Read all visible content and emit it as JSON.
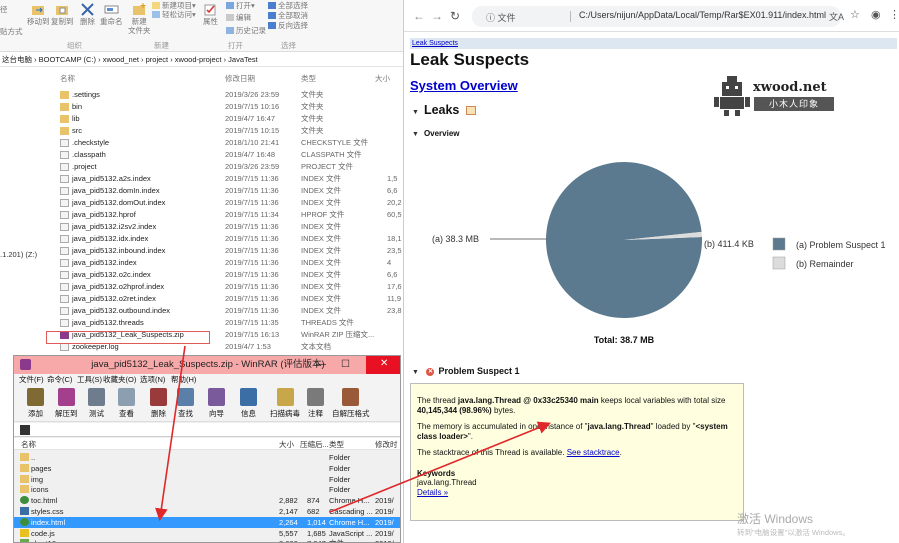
{
  "ribbon": {
    "partial_left": "径",
    "partial_left2": "贴方式",
    "move_to": "移动到",
    "copy_to": "复制到",
    "delete": "删除",
    "rename": "重命名",
    "new_folder_top": "新建",
    "new_folder_bottom": "文件夹",
    "new_item": "新建项目▾",
    "easy_access": "轻松访问▾",
    "properties": "属性",
    "open": "打开▾",
    "edit": "编辑",
    "history": "历史记录",
    "select_all": "全部选择",
    "select_none": "全部取消",
    "invert": "反向选择",
    "group_organize": "组织",
    "group_new": "新建",
    "group_open": "打开",
    "group_select": "选择"
  },
  "explorer": {
    "breadcrumb": "这台电脑 › BOOTCAMP (C:) › xwood_net › project › xwood-project › JavaTest",
    "columns": {
      "name": "名称",
      "date": "修改日期",
      "type": "类型",
      "size": "大小"
    },
    "leftnav_item": ".1.201) (Z:)",
    "files": [
      {
        "name": ".settings",
        "date": "2019/3/26 23:59",
        "type": "文件夹",
        "size": "",
        "icon": "folder-icon"
      },
      {
        "name": "bin",
        "date": "2019/7/15 10:16",
        "type": "文件夹",
        "size": "",
        "icon": "folder-icon"
      },
      {
        "name": "lib",
        "date": "2019/4/7 16:47",
        "type": "文件夹",
        "size": "",
        "icon": "folder-icon"
      },
      {
        "name": "src",
        "date": "2019/7/15 10:15",
        "type": "文件夹",
        "size": "",
        "icon": "folder-icon"
      },
      {
        "name": ".checkstyle",
        "date": "2018/1/10 21:41",
        "type": "CHECKSTYLE 文件",
        "size": "",
        "icon": "file-icon"
      },
      {
        "name": ".classpath",
        "date": "2019/4/7 16:48",
        "type": "CLASSPATH 文件",
        "size": "",
        "icon": "file-icon"
      },
      {
        "name": ".project",
        "date": "2019/3/26 23:59",
        "type": "PROJECT 文件",
        "size": "",
        "icon": "file-icon"
      },
      {
        "name": "java_pid5132.a2s.index",
        "date": "2019/7/15 11:36",
        "type": "INDEX 文件",
        "size": "1,5",
        "icon": "file-icon"
      },
      {
        "name": "java_pid5132.domIn.index",
        "date": "2019/7/15 11:36",
        "type": "INDEX 文件",
        "size": "6,6",
        "icon": "file-icon"
      },
      {
        "name": "java_pid5132.domOut.index",
        "date": "2019/7/15 11:36",
        "type": "INDEX 文件",
        "size": "20,2",
        "icon": "file-icon"
      },
      {
        "name": "java_pid5132.hprof",
        "date": "2019/7/15 11:34",
        "type": "HPROF 文件",
        "size": "60,5",
        "icon": "file-icon"
      },
      {
        "name": "java_pid5132.i2sv2.index",
        "date": "2019/7/15 11:36",
        "type": "INDEX 文件",
        "size": "",
        "icon": "file-icon"
      },
      {
        "name": "java_pid5132.idx.index",
        "date": "2019/7/15 11:36",
        "type": "INDEX 文件",
        "size": "18,1",
        "icon": "file-icon"
      },
      {
        "name": "java_pid5132.inbound.index",
        "date": "2019/7/15 11:36",
        "type": "INDEX 文件",
        "size": "23,5",
        "icon": "file-icon"
      },
      {
        "name": "java_pid5132.index",
        "date": "2019/7/15 11:36",
        "type": "INDEX 文件",
        "size": "4",
        "icon": "file-icon"
      },
      {
        "name": "java_pid5132.o2c.index",
        "date": "2019/7/15 11:36",
        "type": "INDEX 文件",
        "size": "6,6",
        "icon": "file-icon"
      },
      {
        "name": "java_pid5132.o2hprof.index",
        "date": "2019/7/15 11:36",
        "type": "INDEX 文件",
        "size": "17,6",
        "icon": "file-icon"
      },
      {
        "name": "java_pid5132.o2ret.index",
        "date": "2019/7/15 11:36",
        "type": "INDEX 文件",
        "size": "11,9",
        "icon": "file-icon"
      },
      {
        "name": "java_pid5132.outbound.index",
        "date": "2019/7/15 11:36",
        "type": "INDEX 文件",
        "size": "23,8",
        "icon": "file-icon"
      },
      {
        "name": "java_pid5132.threads",
        "date": "2019/7/15 11:35",
        "type": "THREADS 文件",
        "size": "",
        "icon": "file-icon"
      },
      {
        "name": "java_pid5132_Leak_Suspects.zip",
        "date": "2019/7/15 16:13",
        "type": "WinRAR ZIP 压缩文...",
        "size": "",
        "icon": "zip-icon"
      },
      {
        "name": "zookeeper.log",
        "date": "2019/4/7 1:53",
        "type": "文本文档",
        "size": "",
        "icon": "file-icon"
      }
    ]
  },
  "winrar": {
    "title": "java_pid5132_Leak_Suspects.zip - WinRAR (评估版本)",
    "menu": [
      "文件(F)",
      "命令(C)",
      "工具(S)",
      "收藏夹(O)",
      "选项(N)",
      "帮助(H)"
    ],
    "tools": [
      "添加",
      "解压到",
      "测试",
      "查看",
      "删除",
      "查找",
      "向导",
      "信息",
      "扫描病毒",
      "注释",
      "自解压格式"
    ],
    "tool_colors": [
      "#7f6a34",
      "#a33f8c",
      "#6e7c8d",
      "#8c9fb1",
      "#9a3a3a",
      "#5a7fa8",
      "#7a5a9a",
      "#3a6ea5",
      "#c8a64a",
      "#7a7a7a",
      "#9a5a3a"
    ],
    "columns": {
      "name": "名称",
      "size": "大小",
      "packed": "压缩后...",
      "type": "类型",
      "modified": "修改时"
    },
    "rows": [
      {
        "name": "..",
        "size": "",
        "packed": "",
        "type": "Folder",
        "modified": "",
        "icon": "folder-up-icon"
      },
      {
        "name": "pages",
        "size": "",
        "packed": "",
        "type": "Folder",
        "modified": "",
        "icon": "folder-icon"
      },
      {
        "name": "img",
        "size": "",
        "packed": "",
        "type": "Folder",
        "modified": "",
        "icon": "folder-icon"
      },
      {
        "name": "icons",
        "size": "",
        "packed": "",
        "type": "Folder",
        "modified": "",
        "icon": "folder-icon"
      },
      {
        "name": "toc.html",
        "size": "2,882",
        "packed": "874",
        "type": "Chrome H...",
        "modified": "2019/",
        "icon": "chrome-icon"
      },
      {
        "name": "styles.css",
        "size": "2,147",
        "packed": "682",
        "type": "Cascading ...",
        "modified": "2019/",
        "icon": "css-icon"
      },
      {
        "name": "index.html",
        "size": "2,264",
        "packed": "1,014",
        "type": "Chrome H...",
        "modified": "2019/",
        "icon": "chrome-icon"
      },
      {
        "name": "code.js",
        "size": "5,557",
        "packed": "1,685",
        "type": "JavaScript ...",
        "modified": "2019/",
        "icon": "js-icon"
      },
      {
        "name": "chart16.png",
        "size": "8,666",
        "packed": "7,847",
        "type": "文件 png",
        "modified": "2019/",
        "icon": "image-icon"
      }
    ],
    "selected_index": 6
  },
  "chrome": {
    "omnibox_info": "ⓘ 文件",
    "url": "C:/Users/nijun/AppData/Local/Temp/Rar$EX01.911/index.html",
    "breadcrumb_link": "Leak Suspects",
    "title": "Leak Suspects",
    "system_overview": "System Overview",
    "leaks_heading": "Leaks",
    "overview_heading": "Overview",
    "logo_text": "xwood.net",
    "logo_sub": "小木人印象",
    "problem_heading": "Problem Suspect 1",
    "problem_p1_a": "The thread ",
    "problem_p1_b": "java.lang.Thread @ 0x33c25340 main",
    "problem_p1_c": " keeps local variables with total size ",
    "problem_p1_d": "40,145,344 (98.96%)",
    "problem_p1_e": " bytes.",
    "problem_p2_a": "The memory is accumulated in one instance of \"",
    "problem_p2_b": "java.lang.Thread",
    "problem_p2_c": "\" loaded by \"",
    "problem_p2_d": "<system class loader>",
    "problem_p2_e": "\".",
    "problem_p3_a": "The stacktrace of this Thread is available. ",
    "problem_p3_link": "See stacktrace",
    "problem_p3_end": ".",
    "keywords_label": "Keywords",
    "keywords_value": "java.lang.Thread",
    "details_link": "Details »",
    "watermark": "激活 Windows",
    "watermark_sub": "转到\"电脑设置\"以激活 Windows。"
  },
  "chart_data": {
    "type": "pie",
    "slices": [
      {
        "label": "(a)  38.3 MB",
        "legend": "(a)  Problem Suspect 1",
        "value": 38.3,
        "color": "#5b7a8f"
      },
      {
        "label": "(b)  411.4 KB",
        "legend": "(b)  Remainder",
        "value": 0.4114,
        "color": "#dcdcdc"
      }
    ],
    "total_label": "Total: 38.7 MB",
    "legend_position": "right"
  }
}
